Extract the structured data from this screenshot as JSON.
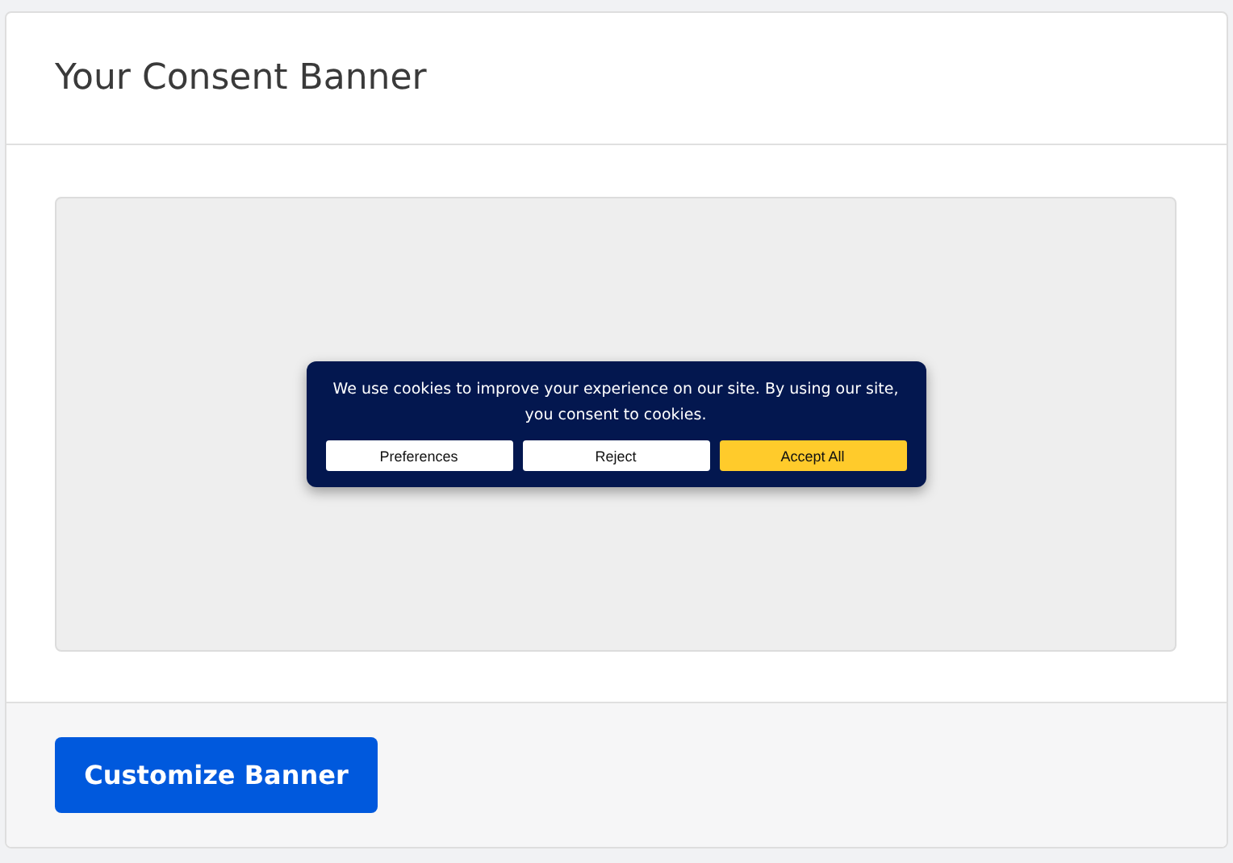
{
  "card": {
    "title": "Your Consent Banner"
  },
  "banner": {
    "message": "We use cookies to improve your experience on our site. By using our site, you consent to cookies.",
    "buttons": [
      {
        "label": "Preferences",
        "kind": "secondary"
      },
      {
        "label": "Reject",
        "kind": "secondary"
      },
      {
        "label": "Accept All",
        "kind": "primary"
      }
    ]
  },
  "footer": {
    "button": "Customize Banner"
  }
}
